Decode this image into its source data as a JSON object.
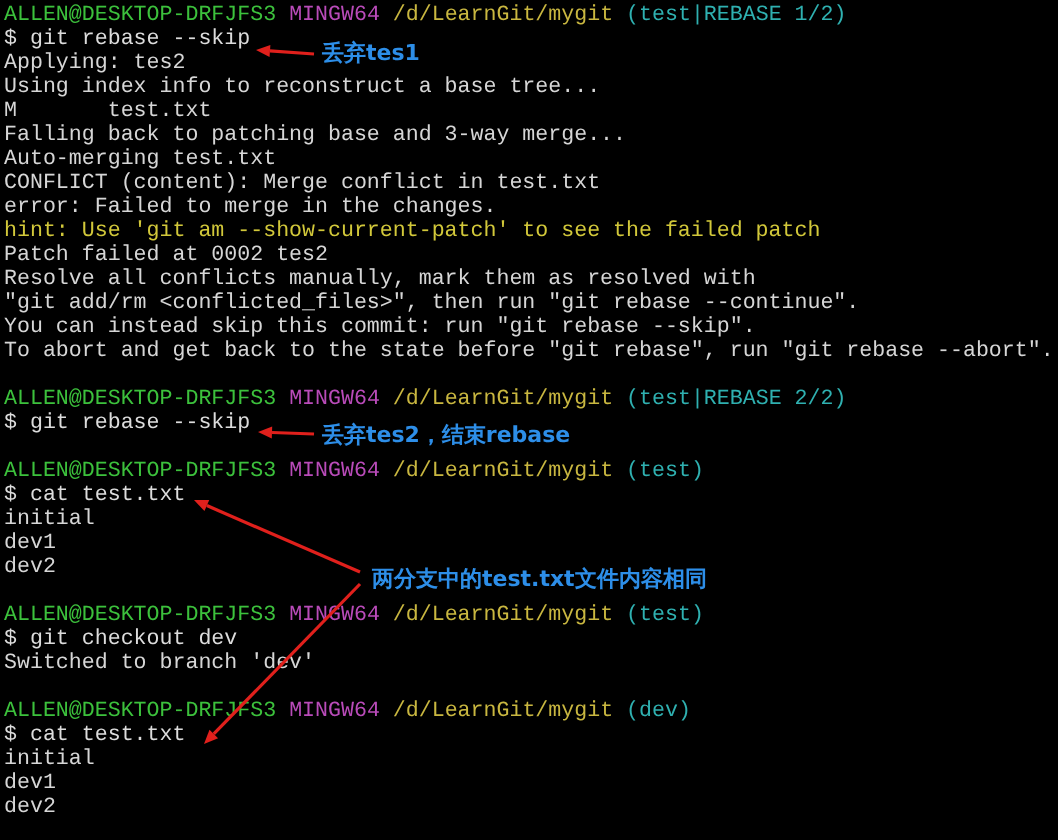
{
  "terminal": {
    "lines": [
      {
        "kind": "prompt",
        "user_host": "ALLEN@DESKTOP-DRFJFS3",
        "shell": "MINGW64",
        "path": "/d/LearnGit/mygit",
        "branch": "(test|REBASE 1/2)"
      },
      {
        "kind": "command",
        "text": "$ git rebase --skip"
      },
      {
        "kind": "output",
        "text": "Applying: tes2"
      },
      {
        "kind": "output",
        "text": "Using index info to reconstruct a base tree..."
      },
      {
        "kind": "output",
        "text": "M       test.txt"
      },
      {
        "kind": "output",
        "text": "Falling back to patching base and 3-way merge..."
      },
      {
        "kind": "output",
        "text": "Auto-merging test.txt"
      },
      {
        "kind": "output",
        "text": "CONFLICT (content): Merge conflict in test.txt"
      },
      {
        "kind": "output",
        "text": "error: Failed to merge in the changes."
      },
      {
        "kind": "hint",
        "text": "hint: Use 'git am --show-current-patch' to see the failed patch"
      },
      {
        "kind": "output",
        "text": "Patch failed at 0002 tes2"
      },
      {
        "kind": "output",
        "text": "Resolve all conflicts manually, mark them as resolved with"
      },
      {
        "kind": "output",
        "text": "\"git add/rm <conflicted_files>\", then run \"git rebase --continue\"."
      },
      {
        "kind": "output",
        "text": "You can instead skip this commit: run \"git rebase --skip\"."
      },
      {
        "kind": "output",
        "text": "To abort and get back to the state before \"git rebase\", run \"git rebase --abort\"."
      },
      {
        "kind": "blank"
      },
      {
        "kind": "prompt",
        "user_host": "ALLEN@DESKTOP-DRFJFS3",
        "shell": "MINGW64",
        "path": "/d/LearnGit/mygit",
        "branch": "(test|REBASE 2/2)"
      },
      {
        "kind": "command",
        "text": "$ git rebase --skip"
      },
      {
        "kind": "blank"
      },
      {
        "kind": "prompt",
        "user_host": "ALLEN@DESKTOP-DRFJFS3",
        "shell": "MINGW64",
        "path": "/d/LearnGit/mygit",
        "branch": "(test)"
      },
      {
        "kind": "command",
        "text": "$ cat test.txt"
      },
      {
        "kind": "output",
        "text": "initial"
      },
      {
        "kind": "output",
        "text": "dev1"
      },
      {
        "kind": "output",
        "text": "dev2"
      },
      {
        "kind": "blank"
      },
      {
        "kind": "prompt",
        "user_host": "ALLEN@DESKTOP-DRFJFS3",
        "shell": "MINGW64",
        "path": "/d/LearnGit/mygit",
        "branch": "(test)"
      },
      {
        "kind": "command",
        "text": "$ git checkout dev"
      },
      {
        "kind": "output",
        "text": "Switched to branch 'dev'"
      },
      {
        "kind": "blank"
      },
      {
        "kind": "prompt",
        "user_host": "ALLEN@DESKTOP-DRFJFS3",
        "shell": "MINGW64",
        "path": "/d/LearnGit/mygit",
        "branch": "(dev)"
      },
      {
        "kind": "command",
        "text": "$ cat test.txt"
      },
      {
        "kind": "output",
        "text": "initial"
      },
      {
        "kind": "output",
        "text": "dev1"
      },
      {
        "kind": "output",
        "text": "dev2"
      }
    ]
  },
  "annotations": [
    {
      "text": "丢弃tes1"
    },
    {
      "text": "丢弃tes2，结束rebase"
    },
    {
      "text": "两分支中的test.txt文件内容相同"
    }
  ]
}
